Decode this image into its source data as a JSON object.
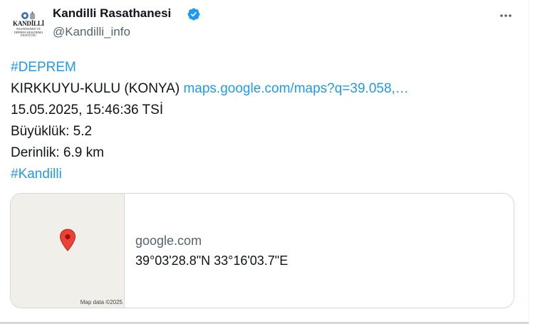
{
  "author": {
    "display_name": "Kandilli Rasathanesi",
    "handle": "@Kandilli_info",
    "avatar_text": "KANDİLLİ",
    "avatar_subtext": "RASATHANESİ VE DEPREM ARAŞTIRMA ENSTİTÜSÜ",
    "verified": true
  },
  "icons": {
    "verified": "verified-badge-icon",
    "more": "more-dots-icon",
    "map_pin": "map-pin-icon"
  },
  "colors": {
    "link": "#1d9bf0",
    "verified": "#1d9bf0",
    "pin": "#ea4335",
    "map_bg": "#f1efe9"
  },
  "tweet": {
    "hashtag_1": "#DEPREM",
    "location": "KIRKKUYU-KULU (KONYA)",
    "map_link": "maps.google.com/maps?q=39.058,…",
    "datetime": "15.05.2025, 15:46:36 TSİ",
    "magnitude": "Büyüklük: 5.2",
    "depth": "Derinlik: 6.9 km",
    "hashtag_2": "#Kandilli"
  },
  "card": {
    "domain": "google.com",
    "title": "39°03'28.8\"N 33°16'03.7\"E",
    "map_attribution": "Map data ©2025"
  }
}
